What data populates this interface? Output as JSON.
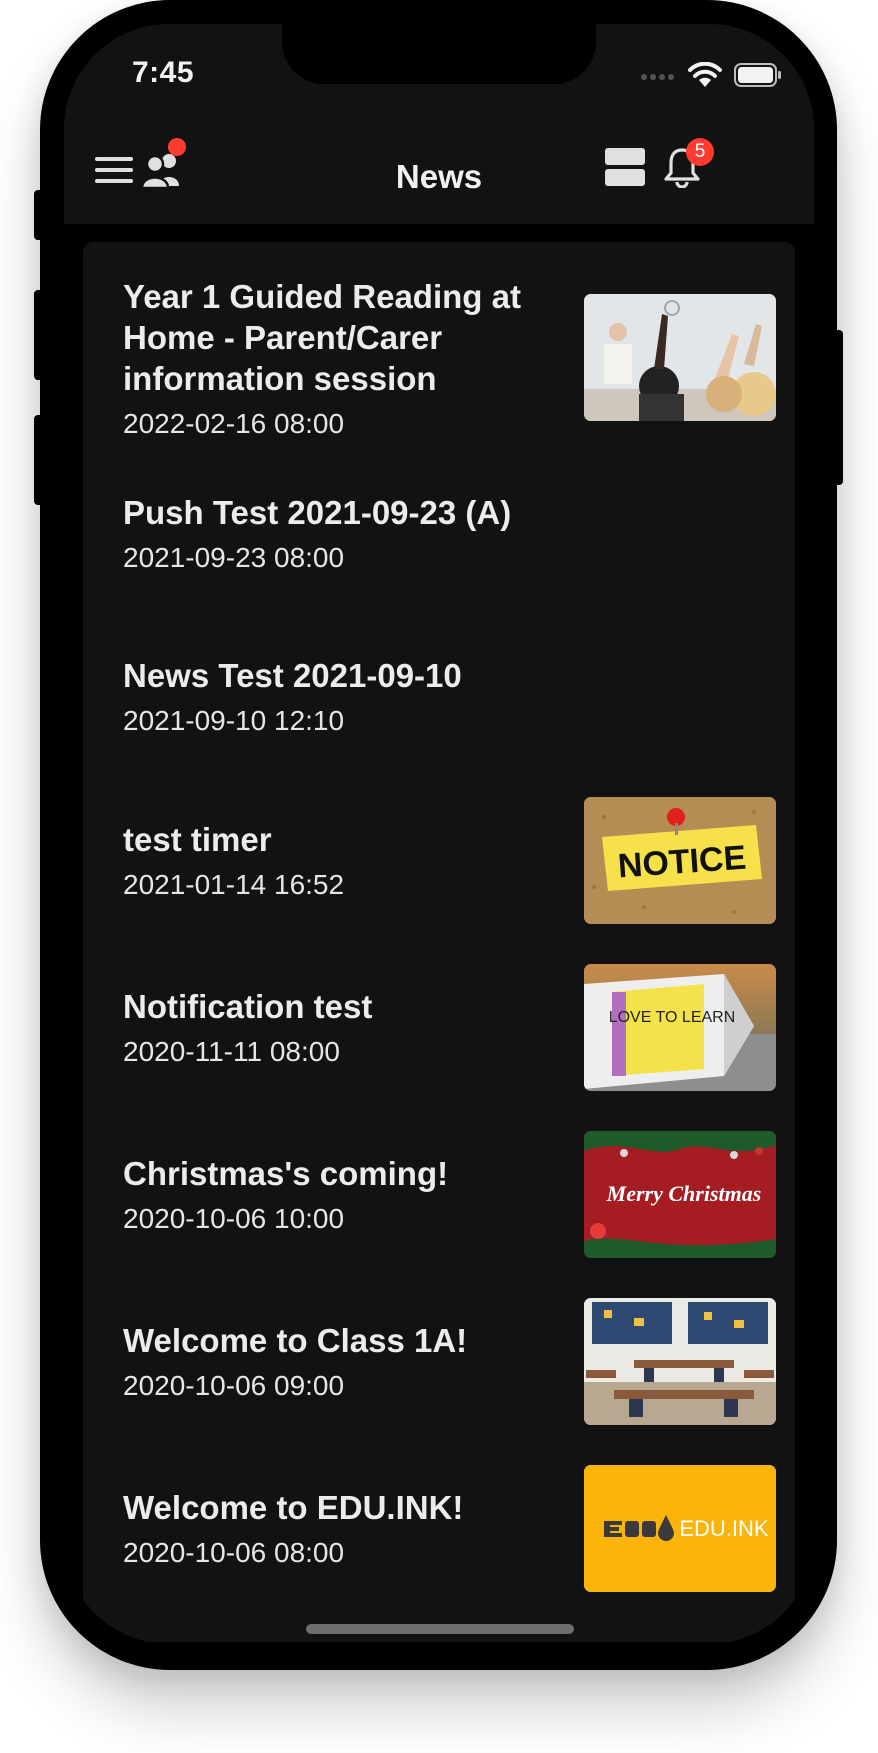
{
  "status_bar": {
    "time": "7:45"
  },
  "nav": {
    "title": "News",
    "notifications_count": "5"
  },
  "news": [
    {
      "title": "Year 1 Guided Reading at Home - Parent/Carer information session",
      "date": "2022-02-16 08:00",
      "thumbnail": "classroom-hands-raised"
    },
    {
      "title": "Push Test 2021-09-23 (A)",
      "date": "2021-09-23 08:00",
      "thumbnail": null
    },
    {
      "title": "News Test 2021-09-10",
      "date": "2021-09-10 12:10",
      "thumbnail": null
    },
    {
      "title": "test timer",
      "date": "2021-01-14 16:52",
      "thumbnail": "notice-corkboard",
      "thumbnail_text": "NOTICE"
    },
    {
      "title": "Notification test",
      "date": "2020-11-11 08:00",
      "thumbnail": "love-to-learn-pencil",
      "thumbnail_text": "LOVE TO LEARN"
    },
    {
      "title": "Christmas's coming!",
      "date": "2020-10-06 10:00",
      "thumbnail": "merry-christmas",
      "thumbnail_text": "Merry Christmas"
    },
    {
      "title": "Welcome to Class 1A!",
      "date": "2020-10-06 09:00",
      "thumbnail": "empty-classroom"
    },
    {
      "title": "Welcome to EDU.INK!",
      "date": "2020-10-06 08:00",
      "thumbnail": "eduink-logo",
      "thumbnail_text": "EDU.INK"
    }
  ],
  "colors": {
    "accent_badge": "#ff3b30",
    "background": "#000000",
    "card": "#121212",
    "logo_yellow": "#fbb40a"
  }
}
